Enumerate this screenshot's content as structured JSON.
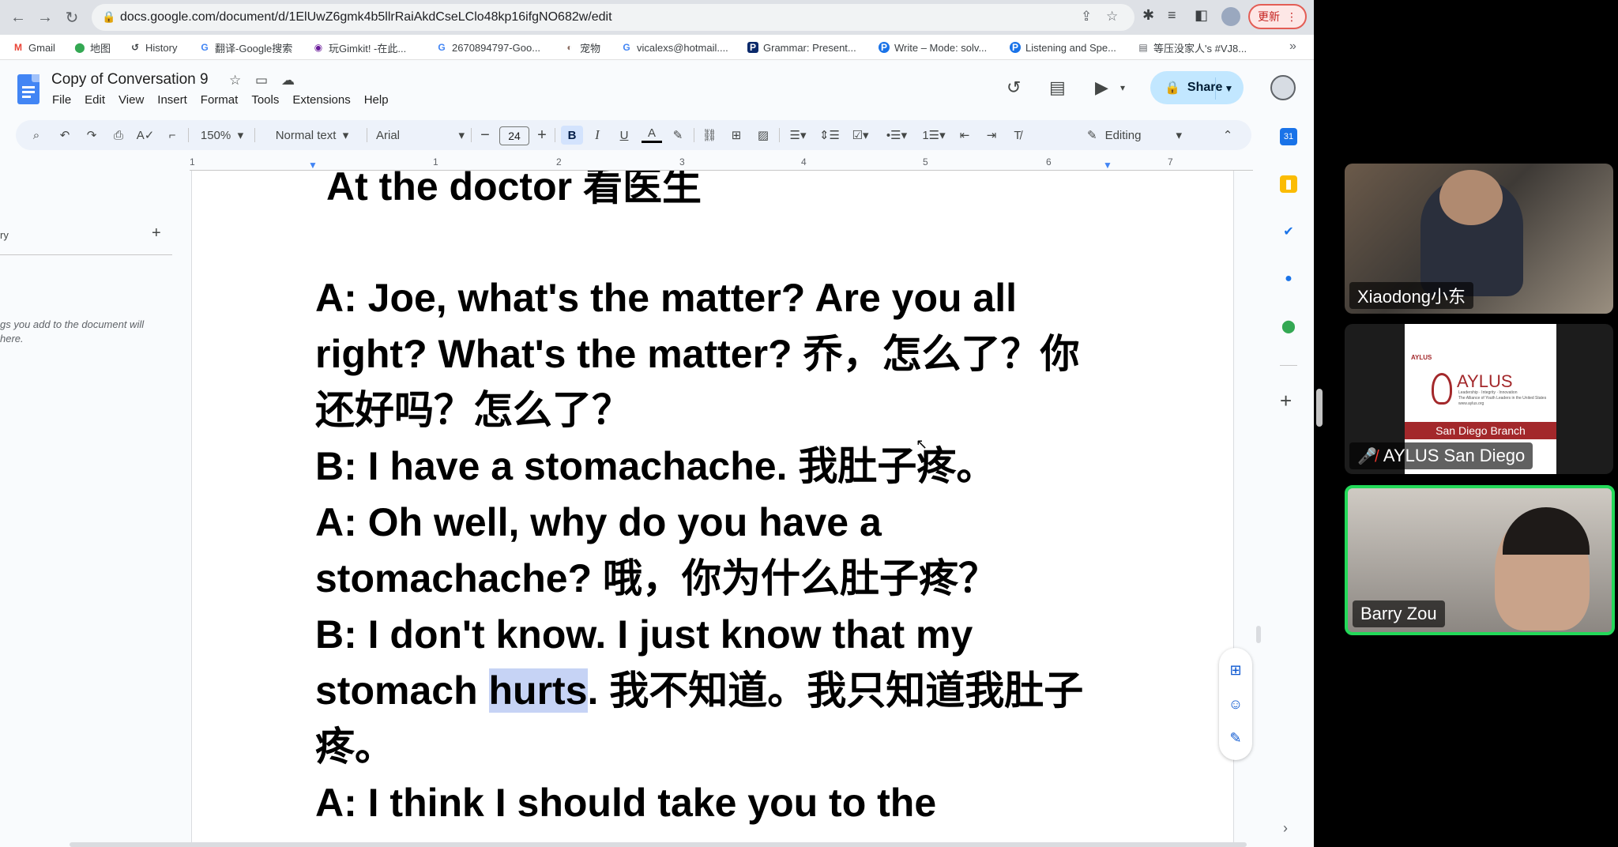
{
  "browser": {
    "url": "docs.google.com/document/d/1ElUwZ6gmk4b5llrRaiAkdCseLClo48kp16ifgNO682w/edit",
    "update_label": "更新",
    "bookmarks": [
      "Gmail",
      "地图",
      "History",
      "翻译-Google搜索",
      "玩Gimkit! -在此...",
      "2670894797-Goo...",
      "宠物",
      "vicalexs@hotmail....",
      "Grammar: Present...",
      "Write – Mode: solv...",
      "Listening and Spe...",
      "等压没家人's #VJ8..."
    ]
  },
  "docs": {
    "title": "Copy of Conversation 9",
    "menu": [
      "File",
      "Edit",
      "View",
      "Insert",
      "Format",
      "Tools",
      "Extensions",
      "Help"
    ],
    "share_label": "Share",
    "toolbar": {
      "zoom": "150%",
      "style": "Normal text",
      "font": "Arial",
      "font_size": "24",
      "mode": "Editing"
    },
    "ruler_numbers": [
      "1",
      "1",
      "2",
      "3",
      "4",
      "5",
      "6",
      "7"
    ]
  },
  "outline": {
    "fragment": "ry",
    "hint": "gs you add to the document will here."
  },
  "document": {
    "heading": "At the doctor 看医生",
    "lines": [
      "A: Joe, what's the matter? Are you all",
      "right? What's the matter? 乔，怎么了？你",
      "还好吗？怎么了？",
      "B: I have a stomachache. 我肚子疼。",
      "A: Oh well, why do you have a",
      "stomachache? 哦，你为什么肚子疼？",
      "B: I don't know. I just know that my",
      "stomach ",
      "疼。",
      "A: I think I should take you to the"
    ],
    "highlighted_word": "hurts",
    "after_highlight": ". 我不知道。我只知道我肚子"
  },
  "participants": [
    {
      "name": "Xiaodong小东",
      "muted": false
    },
    {
      "name": "AYLUS San Diego",
      "muted": true
    },
    {
      "name": "Barry Zou",
      "muted": false
    }
  ],
  "aylus_card": {
    "small_logo": "AYLUS",
    "logo": "AYLUS",
    "tagline": "Leadership · Integrity · Innovation",
    "subtitle": "The Alliance of Youth Leaders in the United States",
    "web": "www.aylus.org",
    "branch": "San Diego Branch"
  },
  "colors": {
    "share_bg": "#c2e7ff",
    "toolbar_bg": "#edf2fa",
    "highlight": "#c6d3f5",
    "active_speaker": "#23d959",
    "aylus_red": "#a3282b"
  }
}
